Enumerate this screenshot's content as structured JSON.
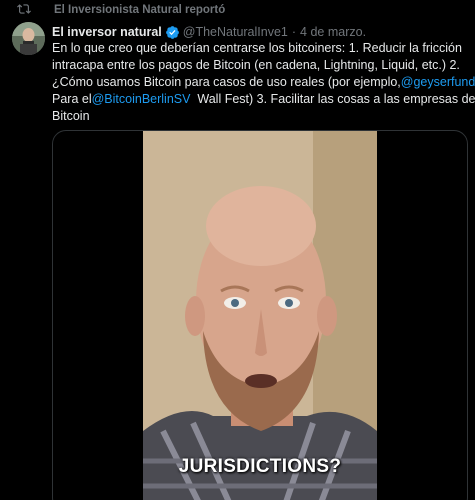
{
  "social_context": {
    "icon": "retweet-icon",
    "text": "El Inversionista Natural reportó"
  },
  "author": {
    "display_name": "El inversor natural",
    "verified_icon": "verified-badge-icon",
    "handle": "@TheNaturalInve1",
    "separator": "·",
    "timestamp": "4 de marzo."
  },
  "tweet": {
    "line1": "En lo que creo que deberían centrarse los bitcoiners: 1. Reducir la fricción",
    "line2": "intracapa entre los pagos de Bitcoin (en cadena, Lightning, Liquid, etc.) 2.",
    "line3_before": "¿Cómo usamos Bitcoin para casos de uso reales (por ejemplo,",
    "mention1": "@geyserfund",
    "line4_before": "Para el",
    "mention2": "@BitcoinBerlinSV",
    "line4_after": "  Wall Fest) 3. Facilitar las cosas a las empresas de",
    "line5": "Bitcoin"
  },
  "media": {
    "caption": "JURISDICTIONS?"
  },
  "colors": {
    "accent": "#1d9bf0",
    "muted": "#71767b",
    "text": "#e7e9ea",
    "background": "#000000"
  }
}
